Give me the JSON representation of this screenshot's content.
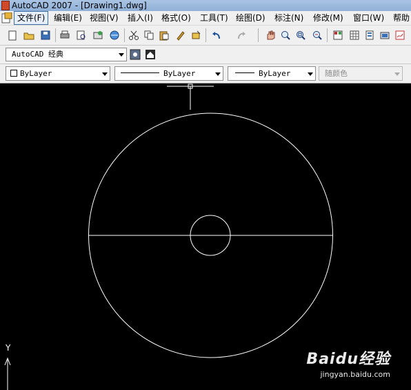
{
  "window": {
    "title": "AutoCAD 2007 - [Drawing1.dwg]"
  },
  "menu": {
    "items": [
      {
        "label": "文件(F)"
      },
      {
        "label": "编辑(E)"
      },
      {
        "label": "视图(V)"
      },
      {
        "label": "插入(I)"
      },
      {
        "label": "格式(O)"
      },
      {
        "label": "工具(T)"
      },
      {
        "label": "绘图(D)"
      },
      {
        "label": "标注(N)"
      },
      {
        "label": "修改(M)"
      },
      {
        "label": "窗口(W)"
      },
      {
        "label": "帮助"
      }
    ]
  },
  "toolbar": {
    "icons": [
      "new-icon",
      "open-icon",
      "save-icon",
      "plot-icon",
      "plot-preview-icon",
      "publish-icon",
      "3d-dwf-icon",
      "cut-icon",
      "copy-icon",
      "paste-icon",
      "match-properties-icon",
      "block-editor-icon",
      "undo-icon",
      "redo-icon",
      "pan-icon",
      "zoom-realtime-icon",
      "zoom-window-icon",
      "zoom-previous-icon",
      "properties-icon",
      "design-center-icon",
      "tool-palettes-icon",
      "sheet-set-icon",
      "markup-icon",
      "quickcalc-icon"
    ]
  },
  "workspace": {
    "value": "AutoCAD 经典"
  },
  "properties": {
    "layer_color": "ByLayer",
    "linetype": "ByLayer",
    "lineweight": "ByLayer",
    "plot_style": "随颜色"
  },
  "canvas": {
    "background": "#000000",
    "stroke": "#ffffff",
    "ucs_y_label": "Y"
  },
  "watermark": {
    "brand": "Baidu经验",
    "site": "jingyan.baidu.com"
  }
}
